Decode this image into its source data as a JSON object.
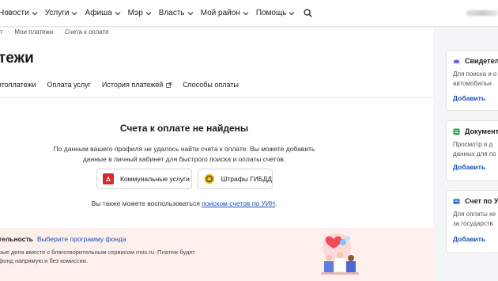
{
  "nav": {
    "items": [
      {
        "label": "Новости"
      },
      {
        "label": "Услуги"
      },
      {
        "label": "Афиша"
      },
      {
        "label": "Мэр"
      },
      {
        "label": "Власть"
      },
      {
        "label": "Мой район"
      },
      {
        "label": "Помощь"
      }
    ],
    "search_icon": "search-icon"
  },
  "breadcrumb": {
    "items": [
      "т",
      "Мои платежи",
      "Счета к оплате"
    ]
  },
  "page": {
    "title": "тежи"
  },
  "tabs": [
    {
      "label": "втоплатежи"
    },
    {
      "label": "Оплата услуг"
    },
    {
      "label": "История платежей",
      "icon": "external-link-icon"
    },
    {
      "label": "Способы оплаты"
    }
  ],
  "empty": {
    "title": "Счета к оплате не найдены",
    "desc_line1": "По данным вашего профиля не удалось найти счета к оплате. Вы можете добавить",
    "desc_line2": "данные в личный кабинет для быстрого поиска и оплаты счетов.",
    "btn_utility": "Коммунальные услуги",
    "btn_fines": "Штрафы ГИБДД",
    "also_prefix": "Вы также можете воспользоваться ",
    "also_link": "поиском счетов по УИН",
    "also_suffix": "."
  },
  "charity": {
    "title": "тельность",
    "link": "Выберите программу фонда",
    "line1": "рые дела вместе с благотворительным сервисом mos.ru. Платеж будет",
    "line2": "фонд напрямую и без комиссии."
  },
  "sidebar": [
    {
      "title": "Свидетел",
      "line1": "Для поиска и о",
      "line2": "автомобильн",
      "action": "Добавить",
      "icon": "car-icon",
      "color": "#6b5bd6"
    },
    {
      "title": "Документ",
      "line1": "Просмотр и д",
      "line2": "данных для по",
      "action": "Добавить",
      "icon": "document-icon",
      "color": "#2ea44f"
    },
    {
      "title": "Счет по УИ",
      "line1": "Для оплаты ке",
      "line2": "за государств",
      "action": "Добавить",
      "icon": "bill-icon",
      "color": "#2b6cd6"
    }
  ],
  "colors": {
    "link": "#1a4fb3",
    "charity_bg": "#fdf0ec"
  }
}
